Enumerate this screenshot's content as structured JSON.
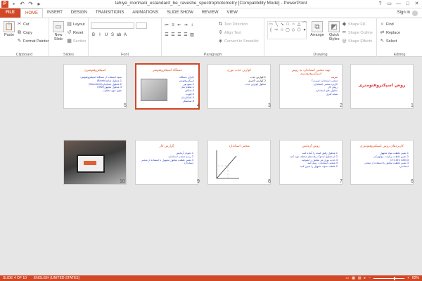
{
  "window": {
    "title": "tahiye_monhani_estandard_be_raveshe_spectrophotometry [Compatibility Mode] - PowerPoint",
    "app_logo": "P",
    "controls": [
      "?",
      "▭",
      "—",
      "□",
      "✕"
    ]
  },
  "tabs": [
    {
      "label": "FILE"
    },
    {
      "label": "HOME"
    },
    {
      "label": "INSERT"
    },
    {
      "label": "DESIGN"
    },
    {
      "label": "TRANSITIONS"
    },
    {
      "label": "ANIMATIONS"
    },
    {
      "label": "SLIDE SHOW"
    },
    {
      "label": "REVIEW"
    },
    {
      "label": "VIEW"
    }
  ],
  "active_tab": "HOME",
  "signin_label": "Sign in",
  "ribbon": {
    "clipboard": {
      "label": "Clipboard",
      "paste": "Paste",
      "cut": "Cut",
      "copy": "Copy",
      "format_painter": "Format Painter"
    },
    "slides": {
      "label": "Slides",
      "new_slide": "New Slide",
      "layout": "Layout",
      "reset": "Reset",
      "section": "Section"
    },
    "font": {
      "label": "Font",
      "font_name": "",
      "font_size": ""
    },
    "paragraph": {
      "label": "Paragraph",
      "text_direction": "Text Direction",
      "align_text": "Align Text",
      "convert_smartart": "Convert to SmartArt"
    },
    "drawing": {
      "label": "Drawing",
      "arrange": "Arrange",
      "quick_styles": "Quick Styles",
      "shape_fill": "Shape Fill",
      "shape_outline": "Shape Outline",
      "shape_effects": "Shape Effects"
    },
    "editing": {
      "label": "Editing",
      "find": "Find",
      "replace": "Replace",
      "select": "Select"
    }
  },
  "slides": [
    {
      "num": "1",
      "title": "روش اسپکتروفتومتری",
      "lines": []
    },
    {
      "num": "2",
      "title": "تهیه منحنی استاندارد به روش اسپکتروفتومتری",
      "lines": [
        "تعریف",
        "منحنی استاندارد چیست؟",
        "کاربرد منحنی استاندارد",
        "روش کار",
        "محلول های استاندارد",
        "نتیجه گیری"
      ]
    },
    {
      "num": "3",
      "title": "کوارتن جذب نوری",
      "lines": [
        "1-کوارتن جذب",
        "2-کوارتن تأخیری",
        "محلول کوارتن جذب"
      ]
    },
    {
      "num": "4",
      "title": "دستگاه اسپکتروفتومتر",
      "lines": [
        "اجزای دستگاه اسپکتروفتومتر",
        "1-منبع نور",
        "2-تکفام ساز",
        "3-شکاف",
        "4-کووت",
        "5-آشکارساز",
        "6-نمایشگر"
      ]
    },
    {
      "num": "5",
      "title": "اسپکتروفتومتری",
      "lines": [
        "نحوه استفاده از دستگاه اسپکتروفتومتر:",
        "1-محلول شاهد(Blank)",
        "2-محلول استاندارد(Standard)",
        "3-محلول مجهول(Test)",
        "طول موج مطلوب"
      ]
    },
    {
      "num": "6",
      "title": "کاربردهای روش اسپکتروفتومتری",
      "lines": [
        "1-تعیین غلظت مواد مجهول",
        "2-تعیین غلظت ترکیبات بیولوژیکی",
        "CT1 AT1 ASIC3",
        "3-تعیین غلظت محلول با استفاده از منحنی استاندارد"
      ]
    },
    {
      "num": "7",
      "title": "روش آزمایش",
      "lines": [
        "1-محلول رقیق کننده را آماده کنید",
        "2-از محلول استوک رقت‌های مختلف تهیه کنید",
        "3-جذب نوری هر محلول را بخوانید",
        "4-منحنی استاندارد رسم کنید",
        "5-غلظت نمونه مجهول را تعیین کنید"
      ]
    },
    {
      "num": "8",
      "title": "منحنی استاندارد",
      "lines": []
    },
    {
      "num": "9",
      "title": "گزارش کار",
      "lines": [
        "1-عنوان آزمایش",
        "2-رسم منحنی استاندارد",
        "3-تعیین غلظت محلول مجهول با استفاده از منحنی استاندارد"
      ]
    },
    {
      "num": "10",
      "title": "",
      "lines": []
    }
  ],
  "status": {
    "slide_of": "SLIDE 4 OF 10",
    "language": "ENGLISH (UNITED STATES)",
    "zoom": "82%"
  },
  "colors": {
    "accent": "#d24726",
    "slide_title": "#e05020",
    "body_text": "#3040c0"
  }
}
